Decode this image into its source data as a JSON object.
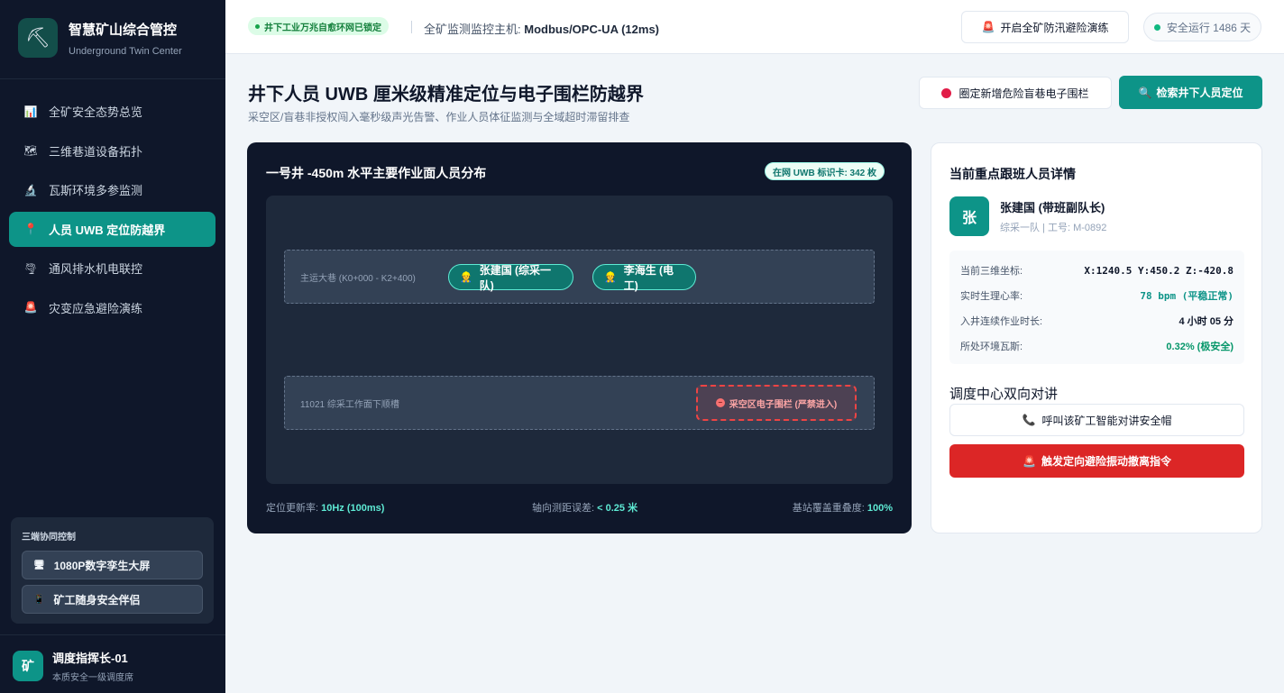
{
  "brand": {
    "logo_icon": "⛏",
    "title": "智慧矿山综合管控",
    "subtitle": "Underground Twin Center"
  },
  "sidebar": {
    "items": [
      {
        "icon": "📊",
        "label": "全矿安全态势总览"
      },
      {
        "icon": "🗺",
        "label": "三维巷道设备拓扑"
      },
      {
        "icon": "🔬",
        "label": "瓦斯环境多参监测"
      },
      {
        "icon": "📍",
        "label": "人员 UWB 定位防越界"
      },
      {
        "icon": "🌪",
        "label": "通风排水机电联控"
      },
      {
        "icon": "🚨",
        "label": "灾变应急避险演练"
      }
    ],
    "active_index": 3,
    "collab": {
      "title": "三端协同控制",
      "buttons": [
        {
          "icon": "🖥",
          "label": "1080P数字孪生大屏"
        },
        {
          "icon": "📱",
          "label": "矿工随身安全伴侣"
        }
      ]
    },
    "user": {
      "avatar": "矿",
      "name": "调度指挥长-01",
      "role": "本质安全一级调度席"
    }
  },
  "topbar": {
    "network_badge": "井下工业万兆自愈环网已锁定",
    "host_label": "全矿监测监控主机:",
    "host_value": "Modbus/OPC-UA (12ms)",
    "drill_icon": "🚨",
    "drill_button": "开启全矿防汛避险演练",
    "safe_days": "安全运行 1486 天"
  },
  "page": {
    "title": "井下人员 UWB 厘米级精准定位与电子围栏防越界",
    "subtitle": "采空区/盲巷非授权闯入毫秒级声光告警、作业人员体征监测与全域超时滞留排查",
    "fence_button": "圈定新增危险盲巷电子围栏",
    "search_icon": "🔍",
    "search_button": "检索井下人员定位"
  },
  "map": {
    "title": "一号井 -450m 水平主要作业面人员分布",
    "badge": "在网 UWB 标识卡: 342 枚",
    "tunnel_1": {
      "label": "主运大巷 (K0+000 - K2+400)",
      "people": [
        {
          "icon": "👷",
          "name": "张建国 (综采一队)"
        },
        {
          "icon": "👷",
          "name": "李海生 (电工)"
        }
      ]
    },
    "tunnel_2": {
      "label": "11021 综采工作面下顺槽",
      "zone_icon": "−",
      "zone_label": "采空区电子围栏 (严禁进入)"
    },
    "stats": [
      {
        "label": "定位更新率:",
        "value": "10Hz (100ms)"
      },
      {
        "label": "轴向测距误差:",
        "value": "< 0.25 米"
      },
      {
        "label": "基站覆盖重叠度:",
        "value": "100%"
      }
    ]
  },
  "detail": {
    "title": "当前重点跟班人员详情",
    "avatar": "张",
    "name": "张建国 (带班副队长)",
    "team": "综采一队 | 工号: M-0892",
    "metrics": [
      {
        "label": "当前三维坐标:",
        "value": "X:1240.5 Y:450.2 Z:-420.8"
      },
      {
        "label": "实时生理心率:",
        "value": "78 bpm (平稳正常)"
      },
      {
        "label": "入井连续作业时长:",
        "value": "4 小时 05 分"
      },
      {
        "label": "所处环境瓦斯:",
        "value": "0.32% (极安全)"
      }
    ],
    "intercom_title": "调度中心双向对讲",
    "call_icon": "📞",
    "call_button": "呼叫该矿工智能对讲安全帽",
    "evac_icon": "🚨",
    "evac_button": "触发定向避险振动撤离指令"
  }
}
